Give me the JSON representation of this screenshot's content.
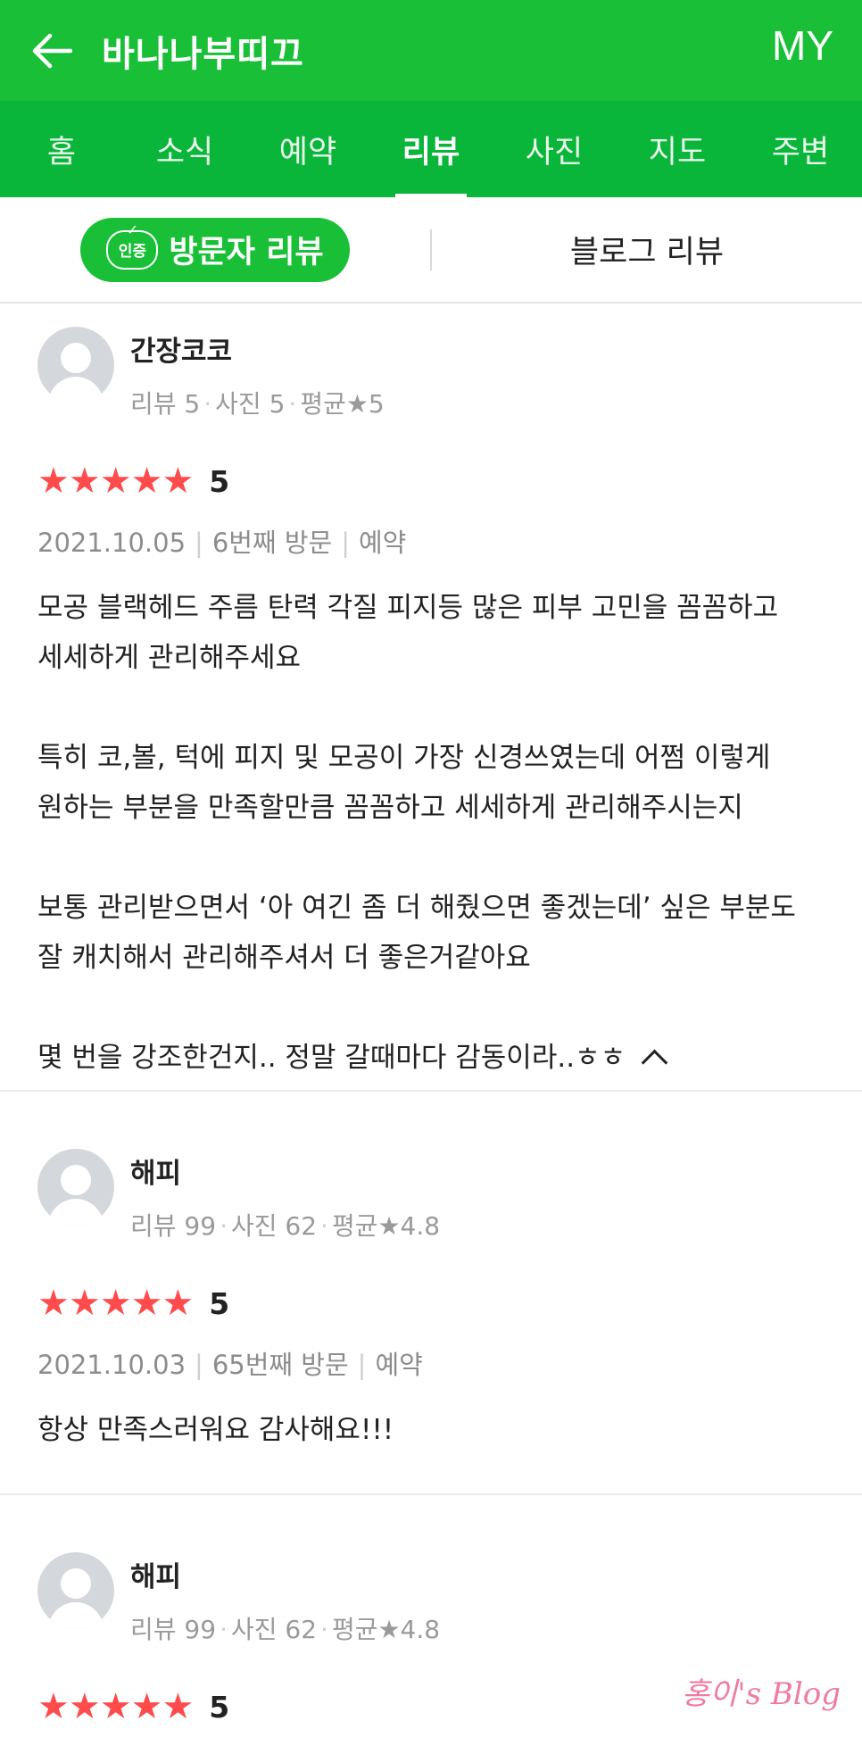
{
  "header": {
    "title": "바나나부띠끄",
    "my_label": "MY"
  },
  "tabs": [
    {
      "label": "홈"
    },
    {
      "label": "소식"
    },
    {
      "label": "예약"
    },
    {
      "label": "리뷰"
    },
    {
      "label": "사진"
    },
    {
      "label": "지도"
    },
    {
      "label": "주변"
    }
  ],
  "active_tab": "리뷰",
  "subtabs": {
    "cert_badge": "인증",
    "visitor": "방문자 리뷰",
    "blog": "블로그 리뷰"
  },
  "reviews": [
    {
      "name": "간장코코",
      "stats": {
        "reviews": "리뷰 5",
        "photos": "사진 5",
        "avg": "평균★5"
      },
      "stars": "★★★★★",
      "score": "5",
      "date": "2021.10.05",
      "visit": "6번째 방문",
      "booking": "예약",
      "content": "모공 블랙헤드 주름 탄력 각질 피지등 많은 피부 고민을 꼼꼼하고\n세세하게 관리해주세요\n\n특히 코,볼, 턱에 피지 및 모공이 가장 신경쓰였는데 어쩜 이렇게\n원하는 부분을 만족할만큼 꼼꼼하고 세세하게 관리해주시는지\n\n보통 관리받으면서 ‘아 여긴 좀 더 해줬으면 좋겠는데’ 싶은 부분도\n잘 캐치해서 관리해주셔서 더 좋은거같아요\n\n몇 번을 강조한건지.. 정말 갈때마다 감동이라..ㅎㅎ"
    },
    {
      "name": "해피",
      "stats": {
        "reviews": "리뷰 99",
        "photos": "사진 62",
        "avg": "평균★4.8"
      },
      "stars": "★★★★★",
      "score": "5",
      "date": "2021.10.03",
      "visit": "65번째 방문",
      "booking": "예약",
      "content": "항상 만족스러워요 감사해요!!!"
    },
    {
      "name": "해피",
      "stats": {
        "reviews": "리뷰 99",
        "photos": "사진 62",
        "avg": "평균★4.8"
      },
      "stars": "★★★★★",
      "score": "5"
    }
  ],
  "watermark": "홍이's Blog",
  "colors": {
    "header_green": "#19c037",
    "tab_green": "#09b63a",
    "star_red": "#ff4b4b"
  }
}
